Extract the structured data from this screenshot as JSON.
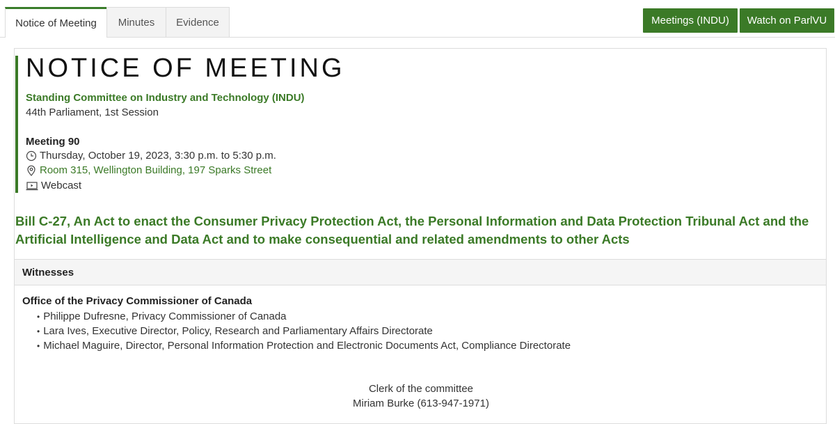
{
  "tabs": [
    {
      "label": "Notice of Meeting",
      "active": true
    },
    {
      "label": "Minutes",
      "active": false
    },
    {
      "label": "Evidence",
      "active": false
    }
  ],
  "buttons": {
    "meetings": "Meetings (INDU)",
    "watch": "Watch on ParlVU"
  },
  "notice": {
    "title": "NOTICE OF MEETING",
    "committee": "Standing Committee on Industry and Technology (INDU)",
    "session": "44th Parliament, 1st Session",
    "meeting_number": "Meeting 90",
    "datetime": "Thursday, October 19, 2023, 3:30 p.m. to 5:30 p.m.",
    "location": "Room 315, Wellington Building, 197 Sparks Street",
    "webcast": "Webcast"
  },
  "bill": "Bill C-27, An Act to enact the Consumer Privacy Protection Act, the Personal Information and Data Protection Tribunal Act and the Artificial Intelligence and Data Act and to make consequential and related amendments to other Acts",
  "witnesses": {
    "header": "Witnesses",
    "organization": "Office of the Privacy Commissioner of Canada",
    "people": [
      "Philippe Dufresne, Privacy Commissioner of Canada",
      "Lara Ives, Executive Director, Policy, Research and Parliamentary Affairs Directorate",
      "Michael Maguire, Director, Personal Information Protection and Electronic Documents Act, Compliance Directorate"
    ]
  },
  "clerk": {
    "title": "Clerk of the committee",
    "name": "Miriam Burke (613-947-1971)"
  },
  "colors": {
    "accent": "#3b7a27",
    "tab_active_border": "#3a7d2a",
    "border": "#dcdcdc"
  }
}
